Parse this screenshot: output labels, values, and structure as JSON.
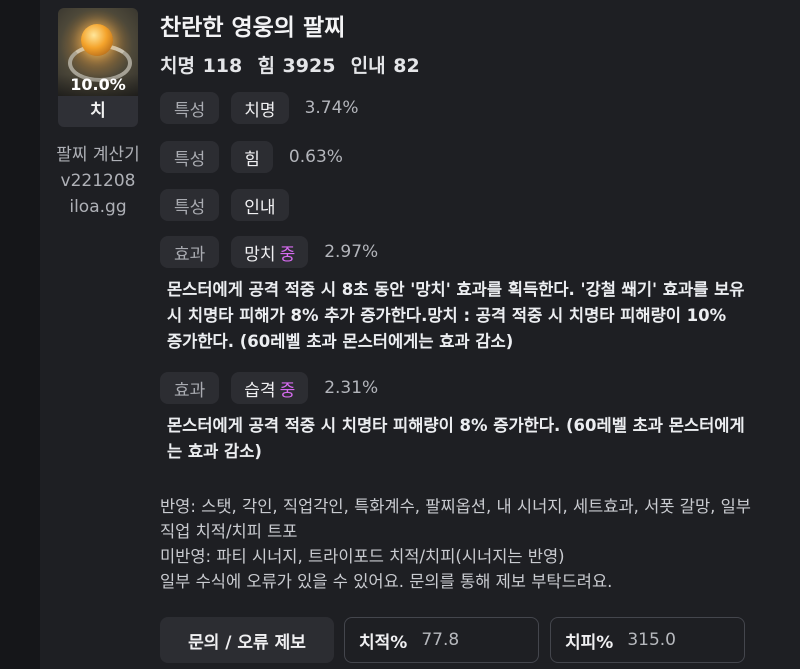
{
  "item": {
    "name": "찬란한 영웅의 팔찌",
    "stats_line": "치명 118  힘 3925  인내 82",
    "icon_percent": "10.0%",
    "stat_tag": "치"
  },
  "calculator": {
    "line1": "팔찌 계산기",
    "line2": "v221208",
    "line3": "iloa.gg"
  },
  "traits": [
    {
      "type": "특성",
      "name": "치명",
      "value": "3.74%"
    },
    {
      "type": "특성",
      "name": "힘",
      "value": "0.63%"
    },
    {
      "type": "특성",
      "name": "인내",
      "value": ""
    }
  ],
  "effects": [
    {
      "type": "효과",
      "name": "망치",
      "grade": "중",
      "value": "2.97%",
      "description": "몬스터에게 공격 적중 시 8초 동안 '망치' 효과를 획득한다. '강철 쐐기' 효과를 보유 시 치명타 피해가 8% 추가 증가한다.망치 : 공격 적중 시 치명타 피해량이 10% 증가한다. (60레벨 초과 몬스터에게는 효과 감소)"
    },
    {
      "type": "효과",
      "name": "습격",
      "grade": "중",
      "value": "2.31%",
      "description": "몬스터에게 공격 적중 시 치명타 피해량이 8% 증가한다. (60레벨 초과 몬스터에게는 효과 감소)"
    }
  ],
  "notes": {
    "applied": "반영: 스탯, 각인, 직업각인, 특화계수, 팔찌옵션, 내 시너지, 세트효과, 서폿 갈망, 일부 직업 치적/치피 트포",
    "not_applied": "미반영: 파티 시너지, 트라이포드 치적/치피(시너지는 반영)",
    "error_notice": "일부 수식에 오류가 있을 수 있어요. 문의를 통해 제보 부탁드려요."
  },
  "footer": {
    "report_button": "문의 / 오류 제보",
    "crit_rate_label": "치적%",
    "crit_rate_value": "77.8",
    "crit_dmg_label": "치피%",
    "crit_dmg_value": "315.0"
  },
  "colors": {
    "background": "#1e1f23",
    "chip": "#2c2d32",
    "grade_accent": "#d66bf0"
  }
}
